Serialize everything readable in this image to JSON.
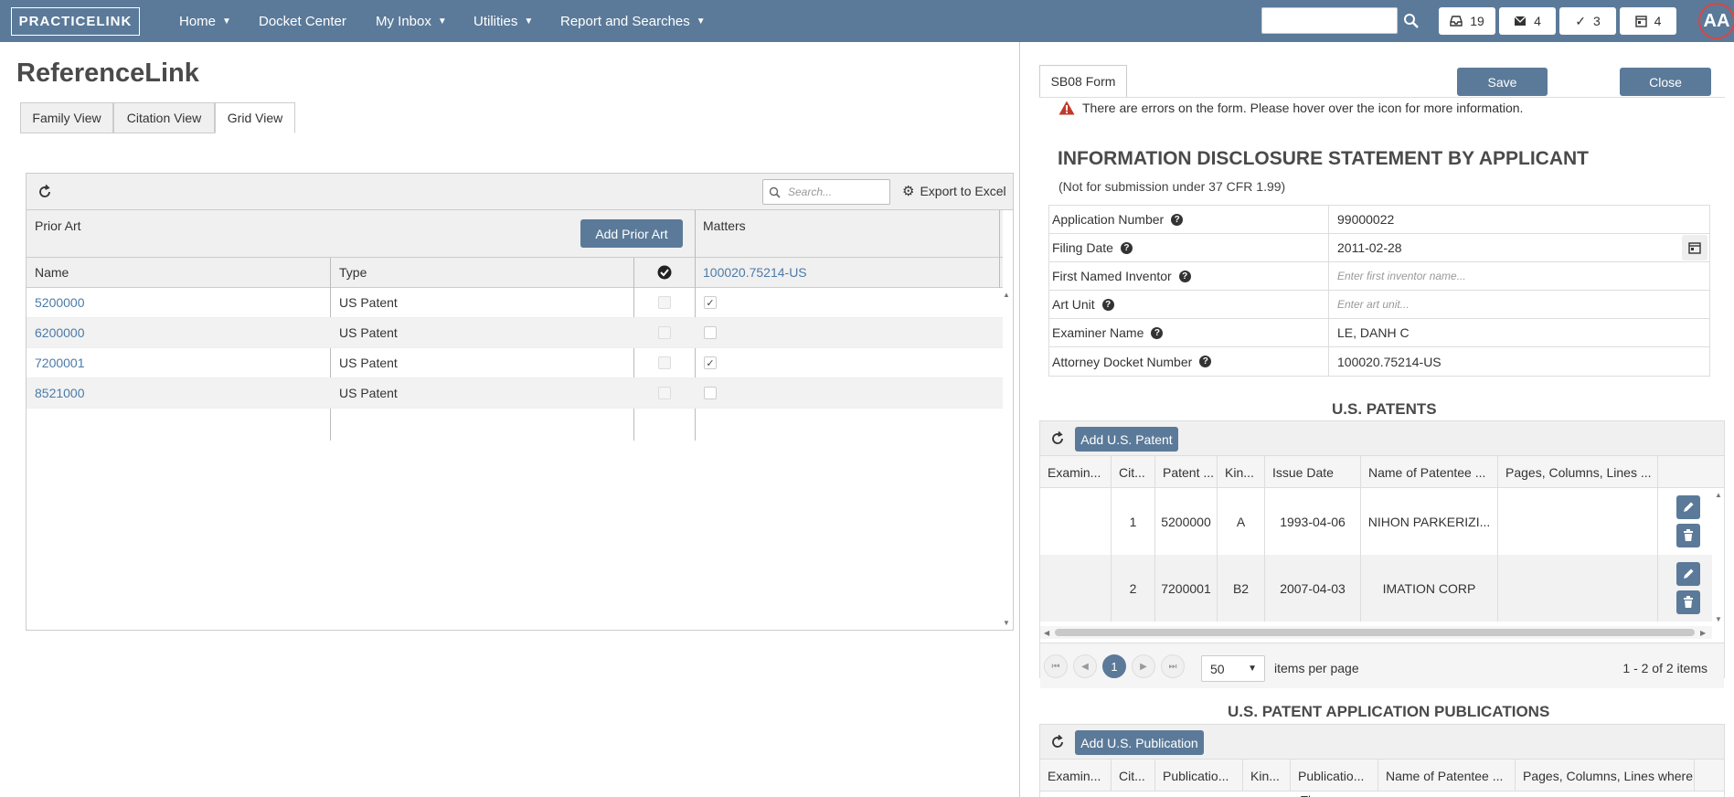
{
  "topbar": {
    "logo": "PRACTICELINK",
    "nav": [
      {
        "label": "Home",
        "caret": true
      },
      {
        "label": "Docket Center",
        "caret": false
      },
      {
        "label": "My Inbox",
        "caret": true
      },
      {
        "label": "Utilities",
        "caret": true
      },
      {
        "label": "Report and Searches",
        "caret": true
      }
    ],
    "counters": {
      "inbox": "19",
      "mail": "4",
      "tasks": "3",
      "calendar": "4"
    },
    "avatar": "AA",
    "accent": "#5b7a99"
  },
  "left": {
    "title": "ReferenceLink",
    "tabs": [
      "Family View",
      "Citation View",
      "Grid View"
    ],
    "active_tab": "Grid View",
    "grid": {
      "search_placeholder": "Search...",
      "export_label": "Export to Excel",
      "prior_art_header": "Prior Art",
      "add_prior_art_label": "Add Prior Art",
      "matters_header": "Matters",
      "col_name": "Name",
      "col_type": "Type",
      "matter_link": "100020.75214-US",
      "rows": [
        {
          "name": "5200000",
          "type": "US Patent",
          "matter_checked": "✓"
        },
        {
          "name": "6200000",
          "type": "US Patent",
          "matter_checked": ""
        },
        {
          "name": "7200001",
          "type": "US Patent",
          "matter_checked": "✓"
        },
        {
          "name": "8521000",
          "type": "US Patent",
          "matter_checked": ""
        }
      ]
    }
  },
  "right": {
    "form_tab": "SB08 Form",
    "save_label": "Save",
    "close_label": "Close",
    "error_text": "There are errors on the form. Please hover over the icon for more information.",
    "ids_title": "INFORMATION DISCLOSURE STATEMENT BY APPLICANT",
    "ids_subtitle": "(Not for submission under 37 CFR 1.99)",
    "fields": {
      "app_number": {
        "label": "Application Number",
        "value": "99000022"
      },
      "filing_date": {
        "label": "Filing Date",
        "value": "2011-02-28"
      },
      "inventor": {
        "label": "First Named Inventor",
        "placeholder": "Enter first inventor name..."
      },
      "art_unit": {
        "label": "Art Unit",
        "placeholder": "Enter art unit..."
      },
      "examiner": {
        "label": "Examiner Name",
        "value": "LE, DANH C"
      },
      "docket": {
        "label": "Attorney Docket Number",
        "value": "100020.75214-US"
      }
    },
    "us_patents": {
      "title": "U.S. PATENTS",
      "add_label": "Add U.S. Patent",
      "columns": [
        "Examin...",
        "Cit...",
        "Patent ...",
        "Kin...",
        "Issue Date",
        "Name of Patentee ...",
        "Pages, Columns, Lines ..."
      ],
      "rows": [
        {
          "cite": "1",
          "patent": "5200000",
          "kind": "A",
          "date": "1993-04-06",
          "patentee": "NIHON PARKERIZI...",
          "pages": ""
        },
        {
          "cite": "2",
          "patent": "7200001",
          "kind": "B2",
          "date": "2007-04-03",
          "patentee": "IMATION CORP",
          "pages": ""
        }
      ],
      "page_current": "1",
      "page_size": "50",
      "items_per_page": "items per page",
      "range": "1 - 2 of 2 items"
    },
    "publications": {
      "title": "U.S. PATENT APPLICATION PUBLICATIONS",
      "add_label": "Add U.S. Publication",
      "columns": [
        "Examin...",
        "Cit...",
        "Publicatio...",
        "Kin...",
        "Publicatio...",
        "Name of Patentee ...",
        "Pages, Columns, Lines where ..."
      ],
      "partial_text": "Th"
    }
  }
}
